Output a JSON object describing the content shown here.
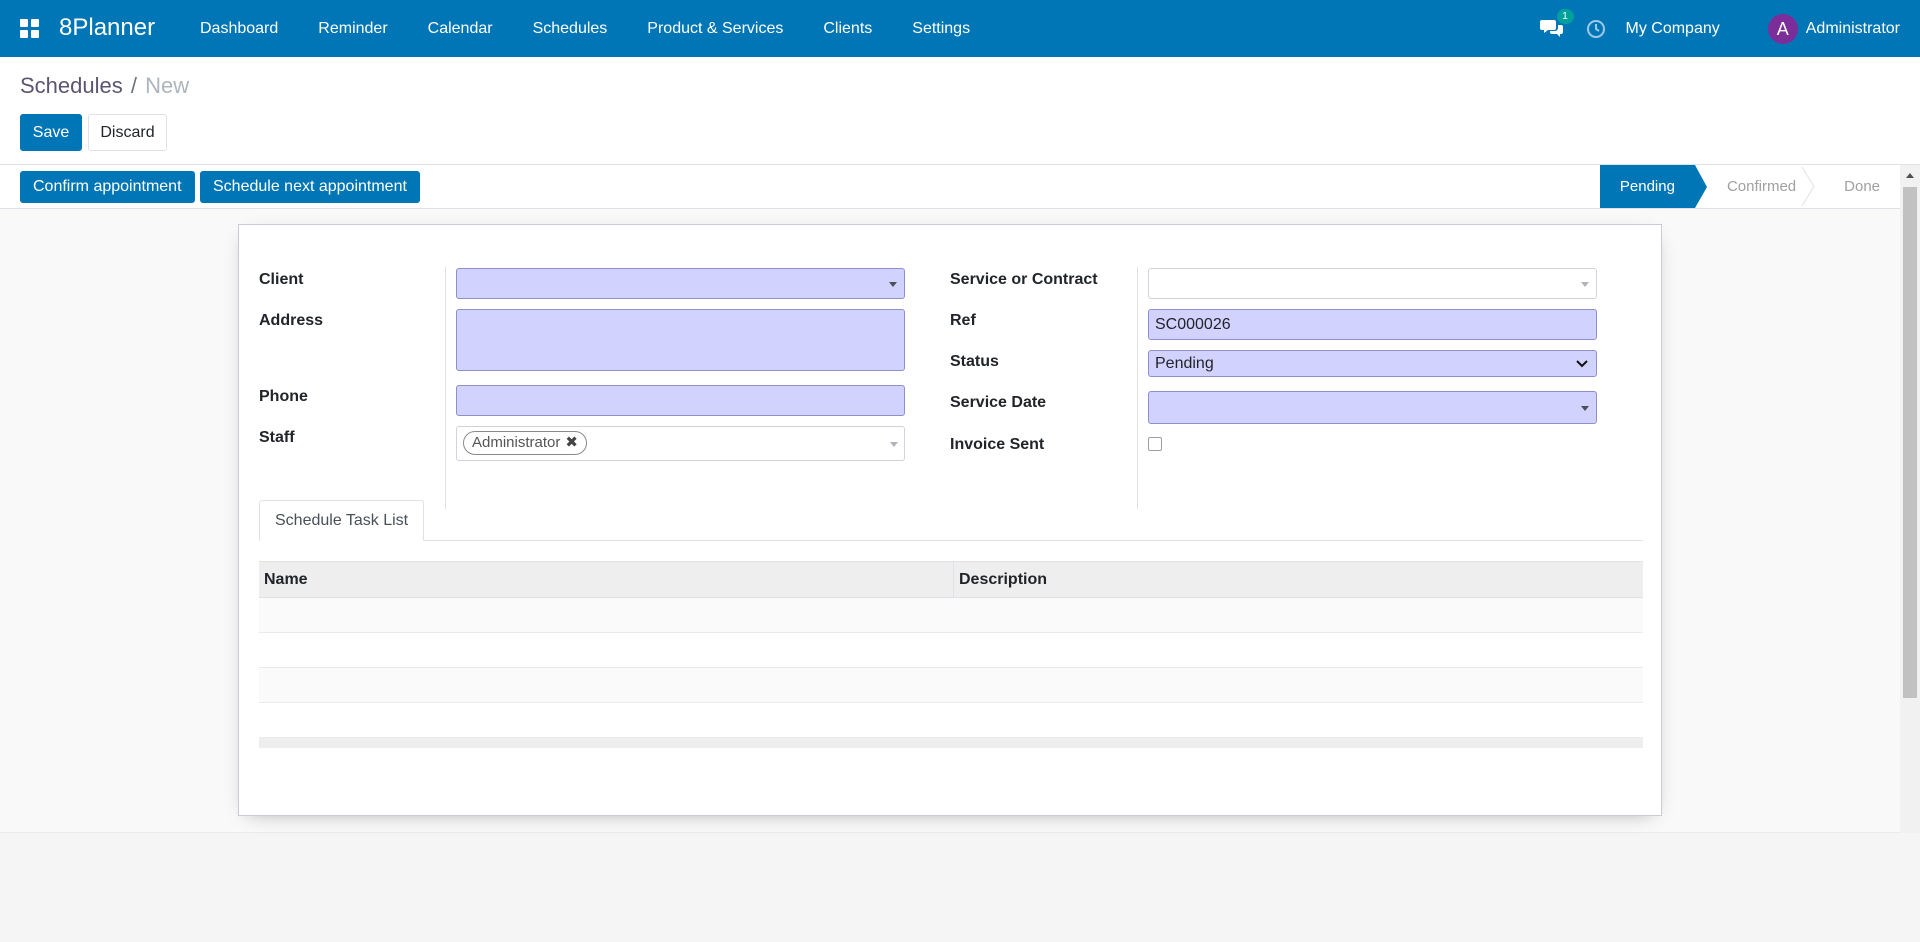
{
  "navbar": {
    "brand": "8Planner",
    "menu": [
      "Dashboard",
      "Reminder",
      "Calendar",
      "Schedules",
      "Product & Services",
      "Clients",
      "Settings"
    ],
    "chat_badge": "1",
    "company": "My Company",
    "user_initial": "A",
    "user_name": "Administrator",
    "brand_color": "#0176b6"
  },
  "breadcrumb": {
    "parent": "Schedules",
    "separator": "/",
    "current": "New"
  },
  "buttons": {
    "save": "Save",
    "discard": "Discard"
  },
  "statusbar": {
    "actions": [
      "Confirm appointment",
      "Schedule next appointment"
    ],
    "stages": [
      "Pending",
      "Confirmed",
      "Done"
    ],
    "active_stage": "Pending"
  },
  "form": {
    "left": {
      "client_label": "Client",
      "client_value": "",
      "address_label": "Address",
      "address_value": "",
      "phone_label": "Phone",
      "phone_value": "",
      "staff_label": "Staff",
      "staff_tag": "Administrator"
    },
    "right": {
      "service_label": "Service or Contract",
      "service_value": "",
      "ref_label": "Ref",
      "ref_value": "SC000026",
      "status_label": "Status",
      "status_value": "Pending",
      "date_label": "Service Date",
      "date_value": "",
      "invoice_label": "Invoice Sent",
      "invoice_checked": false
    }
  },
  "notebook": {
    "tab": "Schedule Task List",
    "columns": [
      "Name",
      "Description"
    ],
    "rows": []
  }
}
